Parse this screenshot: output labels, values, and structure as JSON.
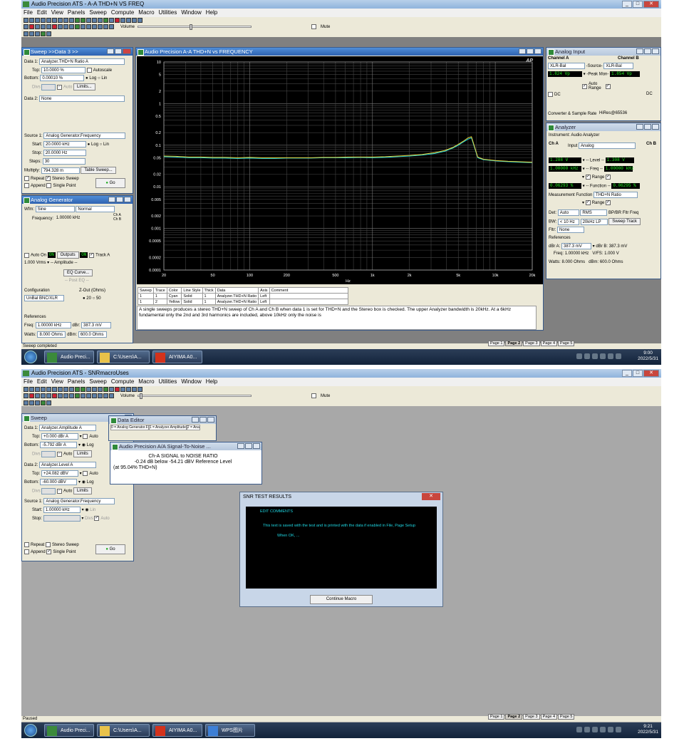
{
  "screen1": {
    "window_title": "Audio Precision ATS - A-A THD+N VS FREQ",
    "menu": [
      "File",
      "Edit",
      "View",
      "Panels",
      "Sweep",
      "Compute",
      "Macro",
      "Utilities",
      "Window",
      "Help"
    ],
    "toolbar": {
      "volume_label": "Volume",
      "mute_label": "Mute"
    },
    "sweep_panel": {
      "title": "Sweep >>Data 3 >>",
      "data1_label": "Data 1:",
      "data1_value": "Analyzer.THD+N Ratio A",
      "top_label": "Top:",
      "top_value": "10.0000  %",
      "autoscale_label": "Autoscale",
      "bottom_label": "Bottom:",
      "bottom_value": "0.00010  %",
      "log_label": "Log",
      "lin_label": "Lin",
      "divs_label": "Divs",
      "auto_label": "Auto",
      "limits_label": "Limits...",
      "data2_label": "Data 2:",
      "data2_value": "None",
      "source1_label": "Source 1:",
      "source1_value": "Analog Generator.Frequency",
      "start_label": "Start:",
      "start_value": "20.0000  kHz",
      "stop_label": "Stop:",
      "stop_value": "20.0000  Hz",
      "steps_label": "Steps:",
      "steps_value": "30",
      "multiply_label": "Multiply:",
      "multiply_value": "794.328  m",
      "table_sweep_label": "Table Sweep...",
      "repeat_label": "Repeat",
      "stereo_sweep_label": "Stereo Sweep",
      "append_label": "Append",
      "single_point_label": "Single Point",
      "go_label": "Go"
    },
    "generator_panel": {
      "title": "Analog Generator",
      "wfm_label": "Wfm:",
      "wfm_value": "Sine",
      "wfm_mode": "Normal",
      "frequency_label": "Frequency:",
      "frequency_value": "1.00000  kHz",
      "cha_label": "Ch A",
      "chb_label": "Ch B",
      "auto_on_label": "Auto On",
      "outputs_label": "Outputs",
      "on_label": "ON",
      "track_a_label": "Track A",
      "amplitude_value": "1.000",
      "amplitude_unit": "Vrms",
      "amplitude_label": "-- Amplitude --",
      "eq_curve_label": "EQ Curve...",
      "post_eq_label": "-- Post EQ --",
      "configuration_label": "Configuration",
      "configuration_value": "UnBal BNC/XLR",
      "zout_label": "Z-Out (Ohms)",
      "z20": "20",
      "z50": "50",
      "references_label": "References",
      "freq_label": "Freq:",
      "freq_value": "1.00000  kHz",
      "dbr_label": "dBr:",
      "dbr_value": "387.3  mV",
      "watts_label": "Watts:",
      "watts_value": "8.000  Ohms",
      "dbm_label": "dBm:",
      "dbm_value": "600.0  Ohms"
    },
    "graph_panel": {
      "title": "Audio Precision   A-A THD+N vs FREQUENCY",
      "ap_logo": "AP",
      "y_unit": "%",
      "x_unit": "Hz",
      "table_headers": [
        "Sweep",
        "Trace",
        "Color",
        "Line Style",
        "Thick",
        "Data",
        "Axis",
        "Comment"
      ],
      "table_rows": [
        [
          "1",
          "1",
          "Cyan",
          "Solid",
          "1",
          "Analyzer.THD+N Ratio",
          "Left",
          ""
        ],
        [
          "1",
          "2",
          "Yellow",
          "Solid",
          "1",
          "Analyzer.THD+N Ratio",
          "Left",
          ""
        ]
      ],
      "comment": "A single sweeps produces a stereo THD+N sweep of Ch A and Ch B when data 1 is set for THD+N and the Stereo box is checked.  The upper Analyzer bandwidth is 20kHz.  At a 6kHz fundamental only the 2nd and 3rd harmonics are included, above 10kHz only the noise is"
    },
    "chart_data": {
      "type": "line",
      "title": "A-A THD+N vs FREQUENCY",
      "xlabel": "Hz",
      "ylabel": "%",
      "xscale": "log",
      "yscale": "log",
      "xlim": [
        20,
        20000
      ],
      "ylim": [
        0.0001,
        10
      ],
      "x_ticks": [
        "20",
        "50",
        "100",
        "200",
        "500",
        "1k",
        "2k",
        "5k",
        "10k",
        "20k"
      ],
      "y_ticks": [
        "10",
        "5",
        "2",
        "1",
        "0.5",
        "0.2",
        "0.1",
        "0.05",
        "0.02",
        "0.01",
        "0.005",
        "0.002",
        "0.001",
        "0.0005",
        "0.0002",
        "0.0001"
      ],
      "series": [
        {
          "color": "#21d7e0",
          "x": [
            20,
            25,
            32,
            40,
            50,
            63,
            80,
            100,
            126,
            159,
            200,
            252,
            317,
            400,
            504,
            635,
            800,
            1007,
            1270,
            1600,
            2016,
            2540,
            3200,
            3900,
            4500,
            5000,
            5500,
            6000,
            6400,
            7200,
            8000,
            10000,
            12700,
            16000,
            20000
          ],
          "y": [
            0.053,
            0.052,
            0.05,
            0.05,
            0.049,
            0.049,
            0.048,
            0.049,
            0.048,
            0.048,
            0.049,
            0.049,
            0.049,
            0.05,
            0.05,
            0.05,
            0.051,
            0.05,
            0.051,
            0.053,
            0.055,
            0.058,
            0.063,
            0.072,
            0.085,
            0.1,
            0.12,
            0.14,
            0.15,
            0.05,
            0.045,
            0.042,
            0.04,
            0.039,
            0.038
          ]
        },
        {
          "color": "#e6d23a",
          "x": [
            20,
            25,
            32,
            40,
            50,
            63,
            80,
            100,
            126,
            159,
            200,
            252,
            317,
            400,
            504,
            635,
            800,
            1007,
            1270,
            1600,
            2016,
            2540,
            3200,
            3900,
            4500,
            5000,
            5500,
            6000,
            6400,
            7200,
            8000,
            10000,
            12700,
            16000,
            20000
          ],
          "y": [
            0.055,
            0.054,
            0.052,
            0.052,
            0.051,
            0.051,
            0.05,
            0.051,
            0.05,
            0.05,
            0.05,
            0.05,
            0.05,
            0.051,
            0.051,
            0.052,
            0.052,
            0.052,
            0.053,
            0.055,
            0.057,
            0.06,
            0.066,
            0.075,
            0.088,
            0.105,
            0.125,
            0.15,
            0.16,
            0.052,
            0.046,
            0.043,
            0.041,
            0.04,
            0.039
          ]
        }
      ]
    },
    "analog_input_panel": {
      "title": "Analog Input",
      "channel_a_label": "Channel A",
      "channel_b_label": "Channel B",
      "cha_source": "XLR-Bal",
      "source_label": "-Source-",
      "chb_source": "XLR-Bal",
      "cha_peak": "1.824  Vp",
      "peak_label": "-Peak Mon-",
      "chb_peak": "1.854  Vp",
      "auto_range_label": "Auto Range",
      "dc_label": "DC",
      "converter_label": "Converter & Sample Rate",
      "converter_value": "HiRes@65536"
    },
    "analyzer_panel": {
      "title": "Analyzer",
      "instrument_label": "Instrument:",
      "instrument_value": "Audio Analyzer",
      "cha_label": "Ch A",
      "input_label": "Input",
      "input_value": "Analog",
      "chb_label": "Ch B",
      "level_a": "1.288  V",
      "level_label": "-- Level --",
      "level_b": "1.308  V",
      "freq_a": "1.00000  kHz",
      "freq_label": "-- Freq --",
      "freq_b": "1.00000  kHz",
      "range_label": "Range",
      "func_a": "0.06293  %",
      "function_label": "-- Function --",
      "func_b": "0.06295  %",
      "meas_func_label": "Measurement Function",
      "meas_func_value": "THD+N Ratio",
      "det_label": "Det:",
      "det_value": "Auto",
      "rms_value": "RMS",
      "bpbr_label": "BP/BR Fltr Freq",
      "bw_label": "BW:",
      "bw_low": "< 10 Hz",
      "bw_high": "20kHz LP",
      "sweep_track_label": "Sweep Track",
      "fltr_label": "Fltr:",
      "fltr_value": "None",
      "references_label": "References",
      "dbra_label": "dBr A:",
      "dbra_value": "387.3  mV",
      "dbrb_label": "dBr B:",
      "dbrb_value": "387.3  mV",
      "freq_ref_label": "Freq:",
      "freq_ref_value": "1.00000  kHz",
      "vfs_label": "V/FS:",
      "vfs_value": "1.000  V",
      "watts_label": "Watts:",
      "watts_value": "8.000  Ohms",
      "dbm_label": "dBm:",
      "dbm_value": "600.0  Ohms"
    },
    "status": "Sweep completed",
    "page_tabs": [
      "Page 1",
      "Page 2",
      "Page 3",
      "Page 4",
      "Page 5"
    ],
    "active_page": "Page 2",
    "taskbar": {
      "item1": "Audio Preci...",
      "item2": "C:\\Users\\A...",
      "item3": "AIYIMA A0...",
      "time": "9:00",
      "date": "2022/5/31"
    }
  },
  "screen2": {
    "window_title": "Audio Precision ATS - SNRmacroUses",
    "sweep_panel": {
      "title": "Sweep",
      "data1_label": "Data 1:",
      "data1_value": "Analyzer.Amplitude A",
      "top_label": "Top:",
      "top_value": "+0.000  dBr A",
      "auto_label": "Auto",
      "bottom_label": "Bottom:",
      "bottom_value": "-5.792  dBr A",
      "log_label": "Log",
      "divs_label": "Divs",
      "limits_label": "Limits",
      "data2_label": "Data 2:",
      "data2_value": "Analyzer.Level A",
      "top2_value": "+24.082  dBV",
      "bottom2_value": "-60.000  dBV",
      "source1_label": "Source 1:",
      "source1_value": "Analog Generator.Frequency",
      "start_label": "Start:",
      "start_value": "1.00000  kHz",
      "lin_label": "Lin",
      "stop_label": "Stop:",
      "repeat_label": "Repeat",
      "stereo_sweep_label": "Stereo Sweep",
      "append_label": "Append",
      "single_point_label": "Single Point",
      "go_label": "Go"
    },
    "data_editor": {
      "title": "Data Editor",
      "cols": [
        "0 = Analog Generator.F",
        "1 = Analyzer.Amplitude",
        "2 = Ana"
      ]
    },
    "snr_window": {
      "title": "Audio Precision   A/A Signal-To-Noise ...",
      "line1": "Ch-A SIGNAL to NOISE RATIO",
      "line2": "-0.24 dB below -54.21 dBV Reference Level",
      "line3": "(at 95.04% THD+N)"
    },
    "dialog": {
      "title": "SNR TEST RESULTS",
      "edit_comments": "EDIT COMMENTS",
      "body_text": "This text is saved with the test and is printed with the data if enabled in File, Page Setup",
      "when_ok": "When OK, ...",
      "continue_label": "Continue Macro"
    },
    "status": "Paused",
    "page_tabs": [
      "Page 1",
      "Page 2",
      "Page 3",
      "Page 4",
      "Page 5"
    ],
    "active_page": "Page 2",
    "taskbar": {
      "item1": "Audio Preci...",
      "item2": "C:\\Users\\A...",
      "item3": "AIYIMA A0...",
      "item4": "WPS图片",
      "time": "9:21",
      "date": "2022/5/31"
    }
  }
}
